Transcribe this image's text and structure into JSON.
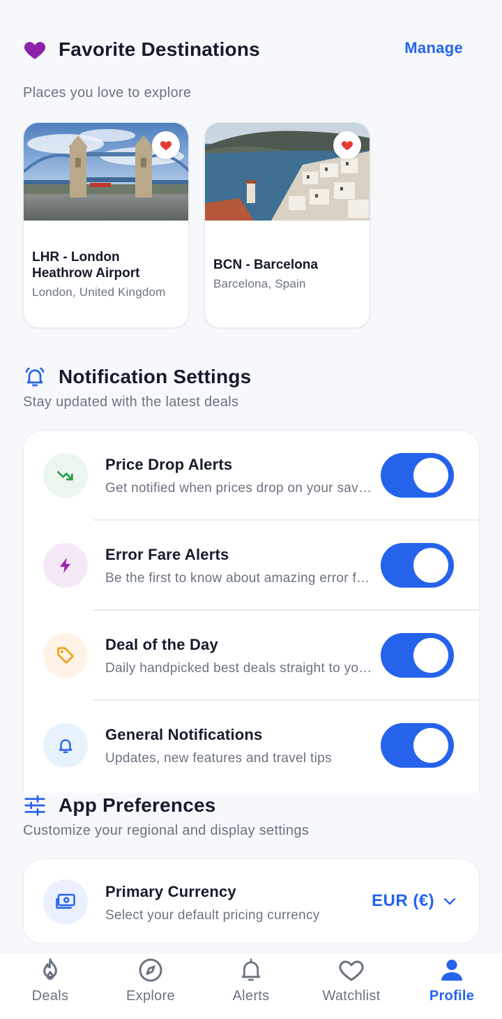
{
  "favorites": {
    "title": "Favorite Destinations",
    "manage_label": "Manage",
    "subtitle": "Places you love to explore",
    "destinations": [
      {
        "name": "LHR - London Heathrow Airport",
        "location": "London, United Kingdom",
        "favorited": true
      },
      {
        "name": "BCN - Barcelona",
        "location": "Barcelona, Spain",
        "favorited": true
      }
    ]
  },
  "notifications": {
    "title": "Notification Settings",
    "subtitle": "Stay updated with the latest deals",
    "items": [
      {
        "title": "Price Drop Alerts",
        "description": "Get notified when prices drop on your saved routes",
        "enabled": true,
        "icon": "trending-down-icon",
        "accent": "#2e9e4f",
        "bg": "#eaf6ee"
      },
      {
        "title": "Error Fare Alerts",
        "description": "Be the first to know about amazing error fares",
        "enabled": true,
        "icon": "lightning-icon",
        "accent": "#9c27b0",
        "bg": "#f5e9f8"
      },
      {
        "title": "Deal of the Day",
        "description": "Daily handpicked best deals straight to your inbox",
        "enabled": true,
        "icon": "tag-icon",
        "accent": "#f59e0b",
        "bg": "#fef3e6"
      },
      {
        "title": "General Notifications",
        "description": "Updates, new features and travel tips",
        "enabled": true,
        "icon": "bell-icon",
        "accent": "#2563eb",
        "bg": "#e8f2fd"
      }
    ]
  },
  "preferences": {
    "title": "App Preferences",
    "subtitle": "Customize your regional and display settings",
    "currency": {
      "title": "Primary Currency",
      "description": "Select your default pricing currency",
      "value": "EUR (€)"
    }
  },
  "nav": {
    "items": [
      {
        "label": "Deals",
        "icon": "flame-icon",
        "active": false
      },
      {
        "label": "Explore",
        "icon": "compass-icon",
        "active": false
      },
      {
        "label": "Alerts",
        "icon": "bell-icon",
        "active": false
      },
      {
        "label": "Watchlist",
        "icon": "heart-icon",
        "active": false
      },
      {
        "label": "Profile",
        "icon": "person-icon",
        "active": true
      }
    ]
  },
  "colors": {
    "accent": "#2563eb",
    "heart": "#8e24aa",
    "fav": "#e53935"
  }
}
